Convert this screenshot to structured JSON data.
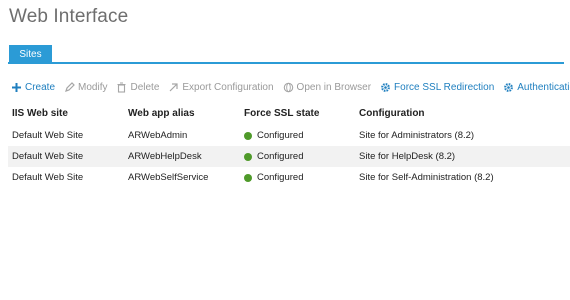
{
  "page": {
    "title": "Web Interface"
  },
  "tabs": [
    {
      "label": "Sites",
      "active": true
    }
  ],
  "toolbar": {
    "create": {
      "label": "Create",
      "icon": "plus-icon",
      "enabled": true
    },
    "modify": {
      "label": "Modify",
      "icon": "pencil-icon",
      "enabled": false
    },
    "delete": {
      "label": "Delete",
      "icon": "trash-icon",
      "enabled": false
    },
    "export": {
      "label": "Export Configuration",
      "icon": "export-arrow-icon",
      "enabled": false
    },
    "open": {
      "label": "Open in Browser",
      "icon": "globe-icon",
      "enabled": false
    },
    "force_ssl": {
      "label": "Force SSL Redirection",
      "icon": "gear-icon",
      "enabled": true
    },
    "auth": {
      "label": "Authentication",
      "icon": "gear-icon",
      "enabled": true
    }
  },
  "table": {
    "columns": [
      "IIS Web site",
      "Web app alias",
      "Force SSL state",
      "Configuration"
    ],
    "rows": [
      {
        "site": "Default Web Site",
        "alias": "ARWebAdmin",
        "ssl": "Configured",
        "config": "Site for Administrators (8.2)"
      },
      {
        "site": "Default Web Site",
        "alias": "ARWebHelpDesk",
        "ssl": "Configured",
        "config": "Site for HelpDesk (8.2)"
      },
      {
        "site": "Default Web Site",
        "alias": "ARWebSelfService",
        "ssl": "Configured",
        "config": "Site for Self-Administration (8.2)"
      }
    ]
  },
  "colors": {
    "accent": "#2b9bd6",
    "link": "#1f7fbf",
    "status_ok": "#4f9a2a",
    "disabled": "#9a9a9a"
  }
}
